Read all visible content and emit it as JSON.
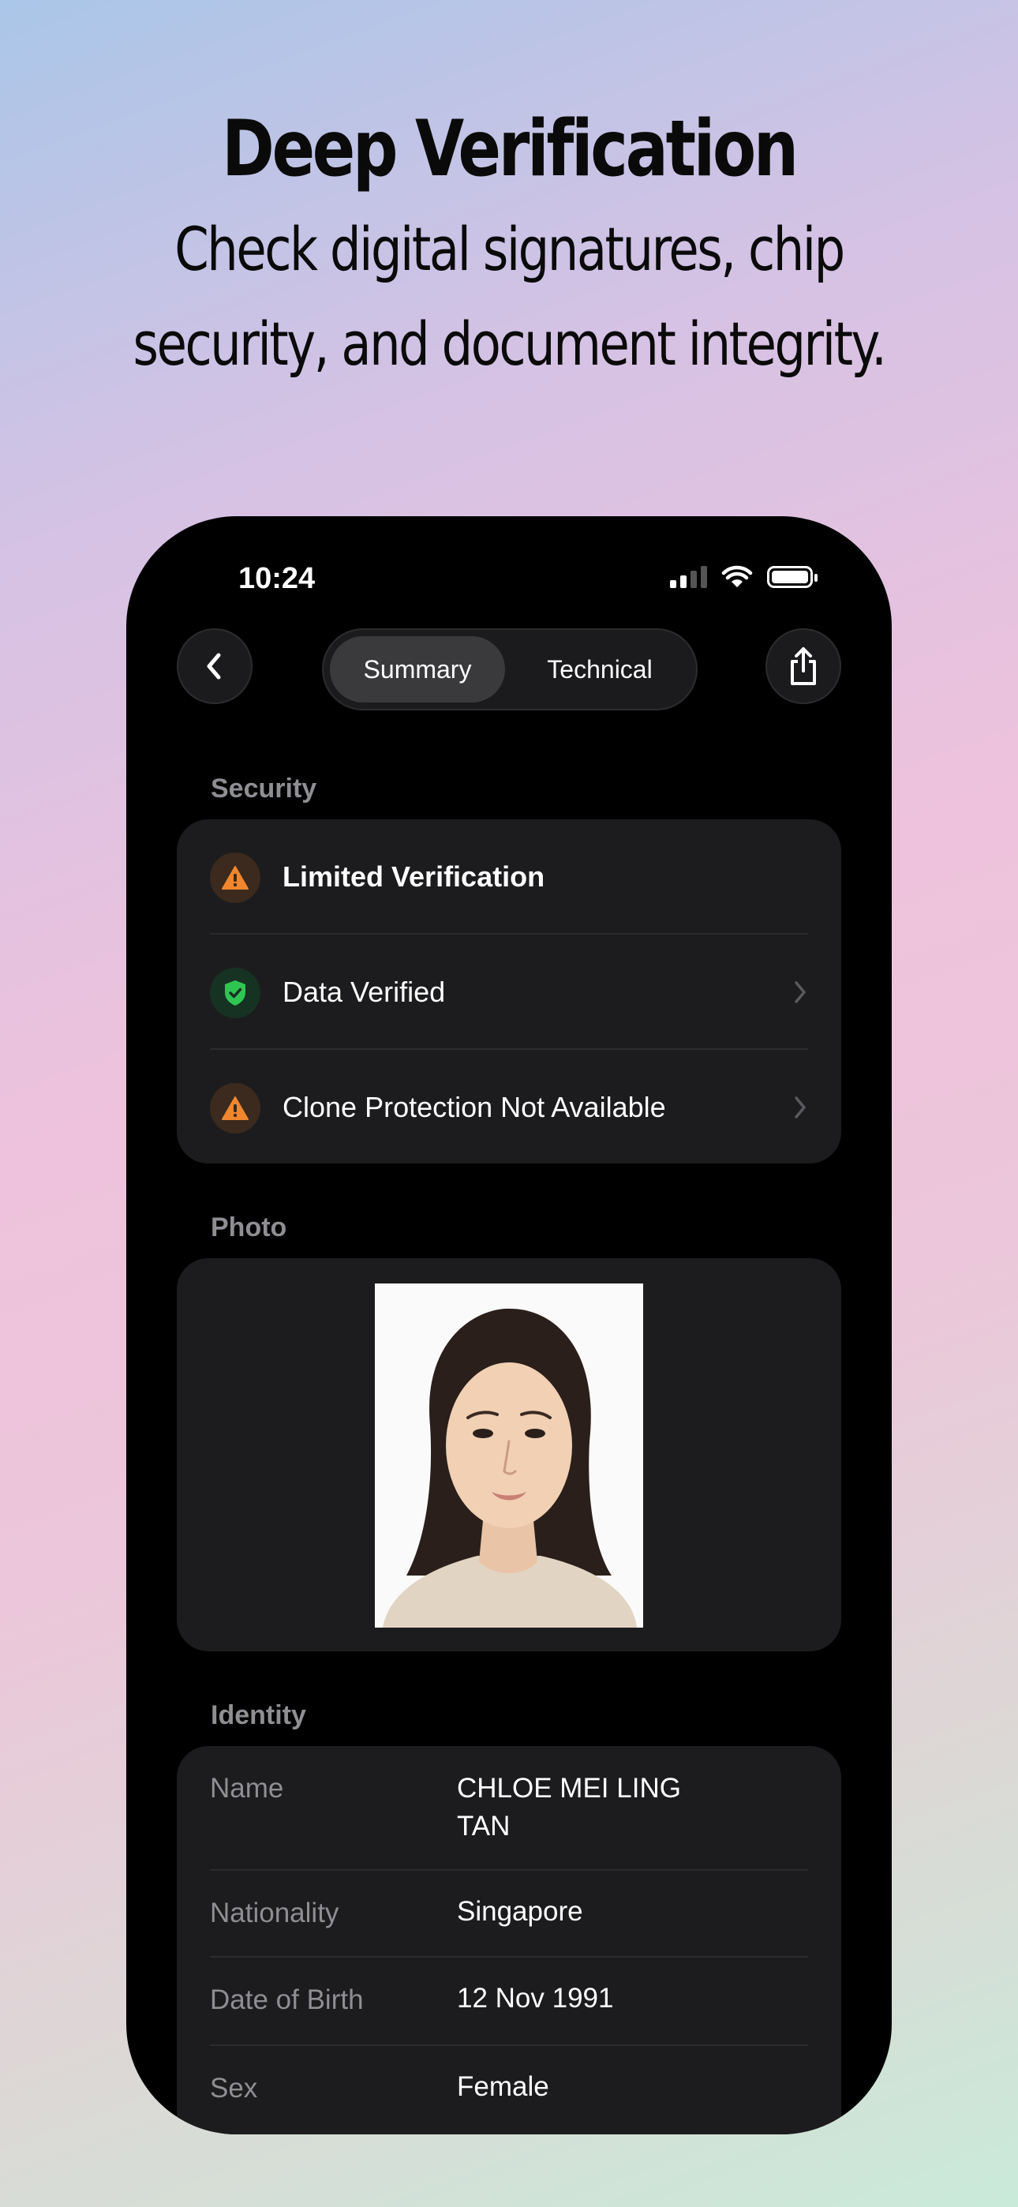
{
  "hero": {
    "title": "Deep Verification",
    "subtitle_line1": "Check digital signatures, chip",
    "subtitle_line2": "security, and document integrity."
  },
  "status_bar": {
    "time": "10:24"
  },
  "nav": {
    "back_icon": "chevron-left-icon",
    "share_icon": "share-icon",
    "tabs": [
      {
        "label": "Summary",
        "selected": true
      },
      {
        "label": "Technical",
        "selected": false
      }
    ]
  },
  "security": {
    "heading": "Security",
    "items": [
      {
        "label": "Limited Verification",
        "icon": "warning-icon",
        "status_color": "#f0862d",
        "has_chevron": false
      },
      {
        "label": "Data Verified",
        "icon": "shield-check-icon",
        "status_color": "#30c552",
        "has_chevron": true
      },
      {
        "label": "Clone Protection Not Available",
        "icon": "warning-icon",
        "status_color": "#f0862d",
        "has_chevron": true
      }
    ]
  },
  "photo": {
    "heading": "Photo"
  },
  "identity": {
    "heading": "Identity",
    "fields": [
      {
        "label": "Name",
        "value_line1": "CHLOE MEI LING",
        "value_line2": "TAN"
      },
      {
        "label": "Nationality",
        "value": "Singapore"
      },
      {
        "label": "Date of Birth",
        "value": "12 Nov 1991"
      },
      {
        "label": "Sex",
        "value": "Female"
      }
    ]
  }
}
